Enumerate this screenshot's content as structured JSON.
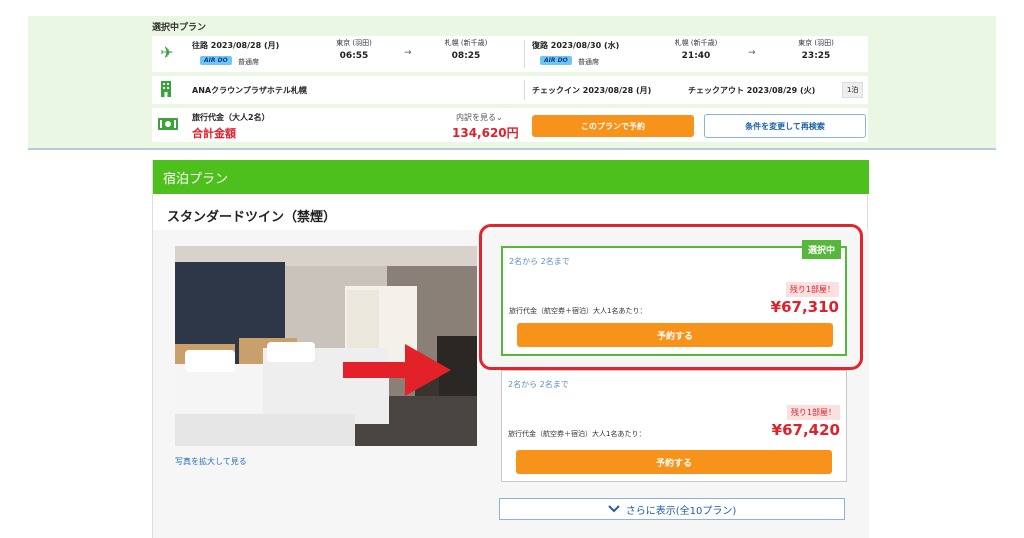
{
  "summary": {
    "title": "選択中プラン",
    "outbound": {
      "label": "往路 2023/08/28 (月)",
      "airline": "AIR DO",
      "seat": "普通席",
      "from_city": "東京 (羽田)",
      "from_time": "06:55",
      "arrow": "→",
      "to_city": "札幌 (新千歳)",
      "to_time": "08:25"
    },
    "return": {
      "label": "復路 2023/08/30 (水)",
      "airline": "AIR DO",
      "seat": "普通席",
      "from_city": "札幌 (新千歳)",
      "from_time": "21:40",
      "arrow": "→",
      "to_city": "東京 (羽田)",
      "to_time": "23:25"
    },
    "hotel": {
      "name": "ANAクラウンプラザホテル札幌",
      "checkin": "チェックイン 2023/08/28 (月)",
      "checkout": "チェックアウト 2023/08/29 (火)",
      "nights": "1泊"
    },
    "fare": {
      "label": "旅行代金（大人2名）",
      "total_label": "合計金額",
      "breakdown_link": "内訳を見る",
      "total_price": "134,620円",
      "book_button": "このプランで予約",
      "research_button": "条件を変更して再検索"
    }
  },
  "plan": {
    "header": "宿泊プラン",
    "room_title": "スタンダードツイン（禁煙）",
    "enlarge_link": "写真を拡大して見る",
    "cards": [
      {
        "capacity": "2名から 2名まで",
        "rooms_left": "残り1部屋！",
        "price_label": "旅行代金（航空券＋宿泊）大人1名あたり：",
        "price": "¥67,310",
        "reserve_button": "予約する",
        "badge": "選択中"
      },
      {
        "capacity": "2名から 2名まで",
        "rooms_left": "残り1部屋！",
        "price_label": "旅行代金（航空券＋宿泊）大人1名あたり：",
        "price": "¥67,420",
        "reserve_button": "予約する"
      }
    ],
    "more_button": "さらに表示(全10プラン)"
  },
  "colors": {
    "brand_green": "#4ec01e",
    "accent_orange": "#f7931a",
    "price_red": "#e0202a",
    "link_blue": "#1a5fa8"
  },
  "icons": [
    "airplane-icon",
    "hotel-icon",
    "money-icon",
    "chevron-down-icon",
    "right-arrow-icon"
  ]
}
